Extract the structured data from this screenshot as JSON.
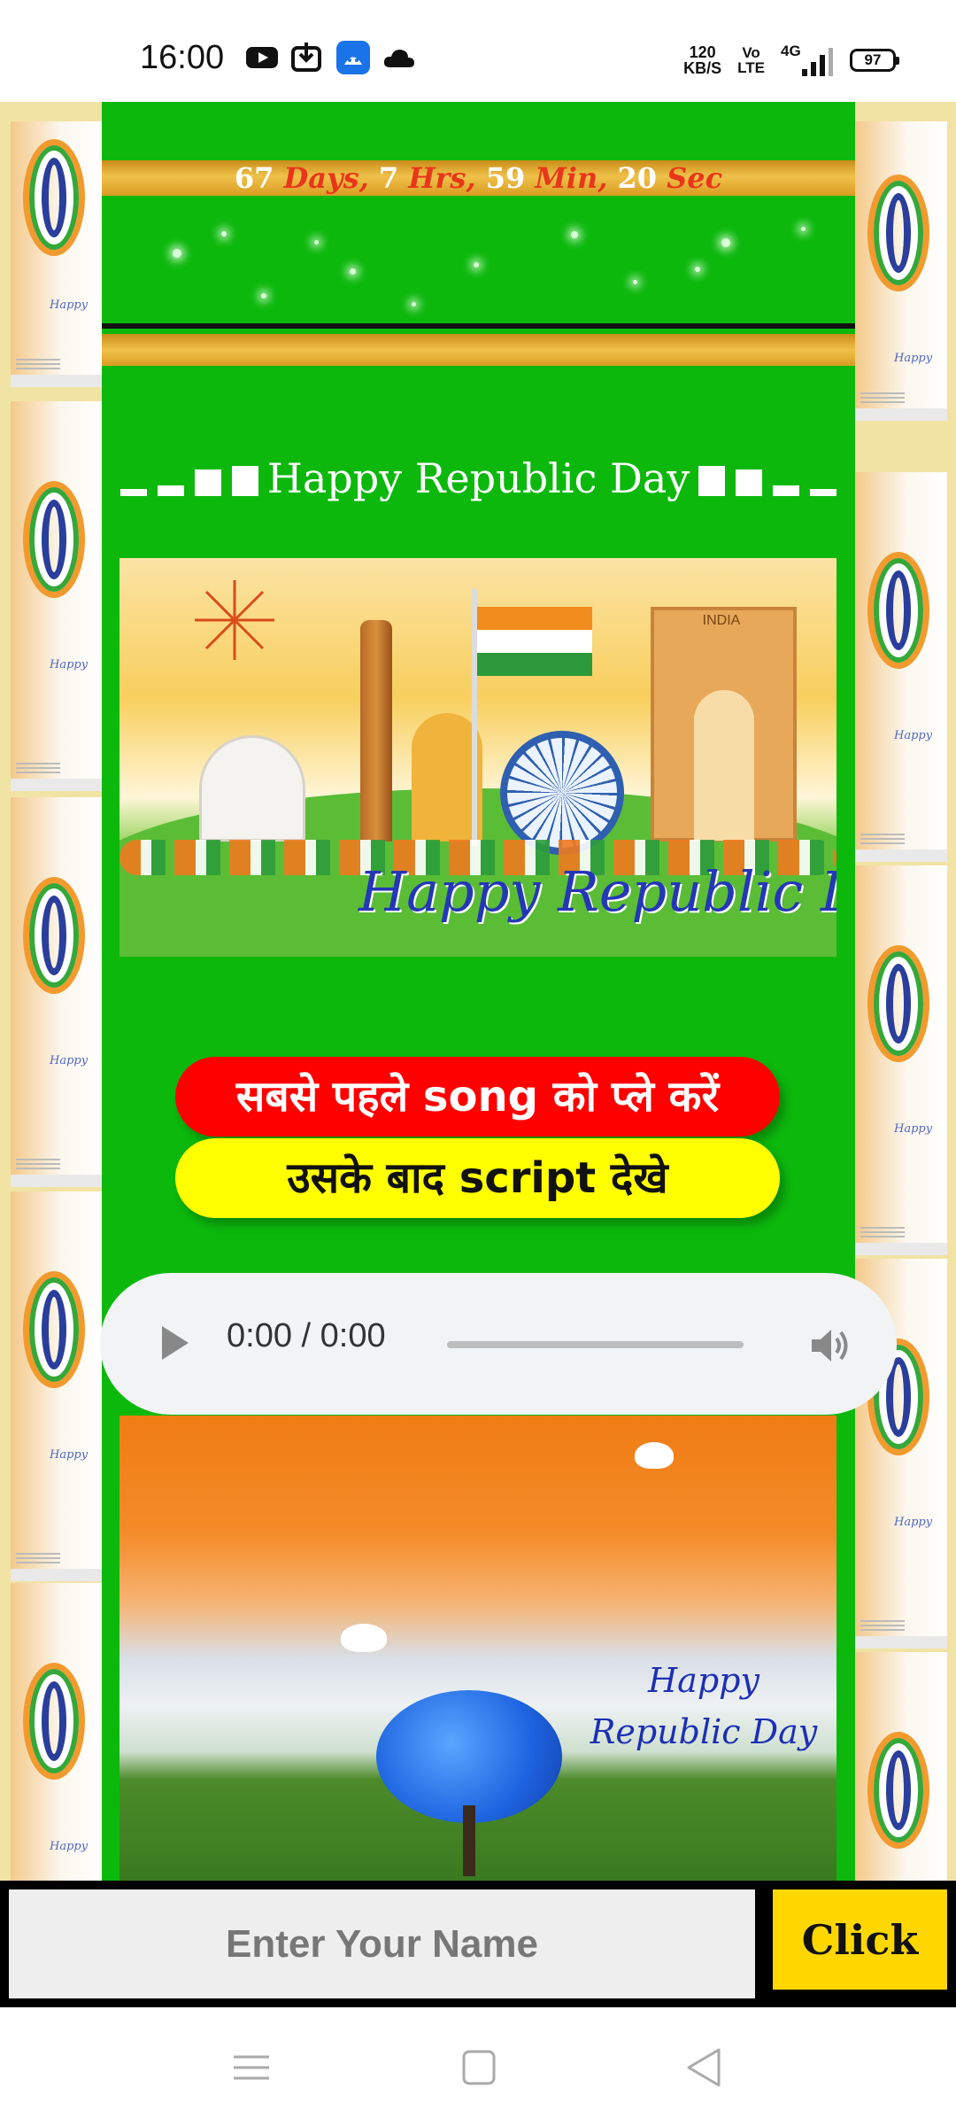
{
  "status_bar": {
    "time": "16:00",
    "net_speed_value": "120",
    "net_speed_unit": "KB/S",
    "volte_top": "Vo",
    "volte_bottom": "LTE",
    "signal_label": "4G",
    "battery": "97",
    "left_icons": [
      "youtube-icon",
      "download-icon",
      "android-app-icon",
      "cloud-icon"
    ]
  },
  "countdown": {
    "days": "67",
    "days_unit": "Days,",
    "hours": "7",
    "hours_unit": "Hrs,",
    "minutes": "59",
    "minutes_unit": "Min,",
    "seconds": "20",
    "seconds_unit": "Sec"
  },
  "heading": "Happy Republic Day",
  "banner1": {
    "gate_label": "INDIA",
    "text": "Happy Republic Day"
  },
  "buttons": {
    "play_song": "सबसे पहले song को प्ले करें",
    "view_script": "उसके बाद script देखे"
  },
  "audio": {
    "time": "0:00 / 0:00",
    "progress": 0
  },
  "banner2": {
    "line1": "Happy",
    "line2": "Republic Day"
  },
  "name_form": {
    "placeholder": "Enter Your Name",
    "button_label": "Click"
  },
  "colors": {
    "page_green": "#0cb80c",
    "red_button": "#ff0000",
    "yellow_button": "#ffff00",
    "click_button": "#ffd700",
    "countdown_unit": "#e8361a"
  }
}
